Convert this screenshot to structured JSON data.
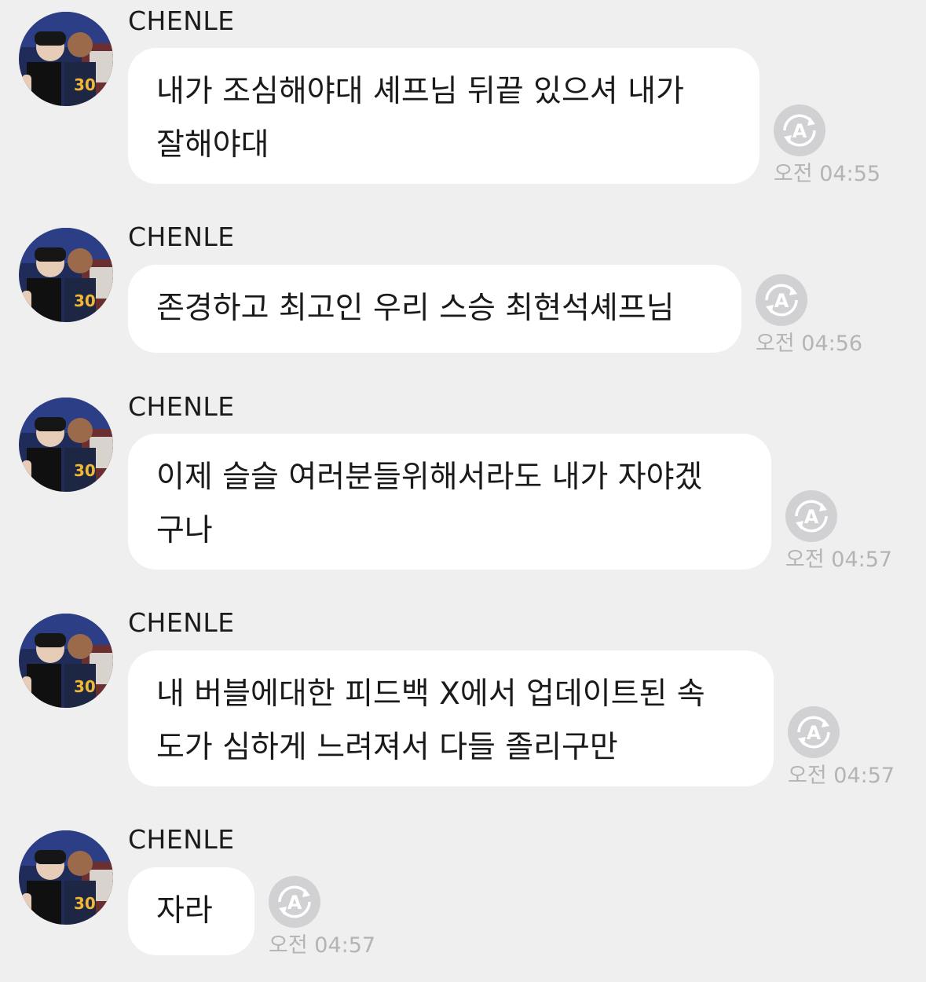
{
  "messages": [
    {
      "sender": "CHENLE",
      "lines": [
        "내가 조심해야대 셰프님 뒤끝 있으셔 내가",
        "잘해야대"
      ],
      "time": "오전 04:55",
      "icon": "auto-translate-icon"
    },
    {
      "sender": "CHENLE",
      "lines": [
        "존경하고 최고인 우리 스승 최현석셰프님"
      ],
      "time": "오전 04:56",
      "icon": "auto-translate-icon"
    },
    {
      "sender": "CHENLE",
      "lines": [
        "이제 슬슬 여러분들위해서라도 내가 자야겠",
        "구나"
      ],
      "time": "오전 04:57",
      "icon": "auto-translate-icon"
    },
    {
      "sender": "CHENLE",
      "lines": [
        "내 버블에대한 피드백 X에서 업데이트된 속",
        "도가 심하게 느려져서 다들 졸리구만"
      ],
      "time": "오전 04:57",
      "icon": "auto-translate-icon"
    },
    {
      "sender": "CHENLE",
      "lines": [
        "자라"
      ],
      "time": "오전 04:57",
      "icon": "auto-translate-icon"
    }
  ],
  "colors": {
    "background": "#efeff0",
    "bubble": "#ffffff",
    "timestamp": "#b4b4b6"
  }
}
